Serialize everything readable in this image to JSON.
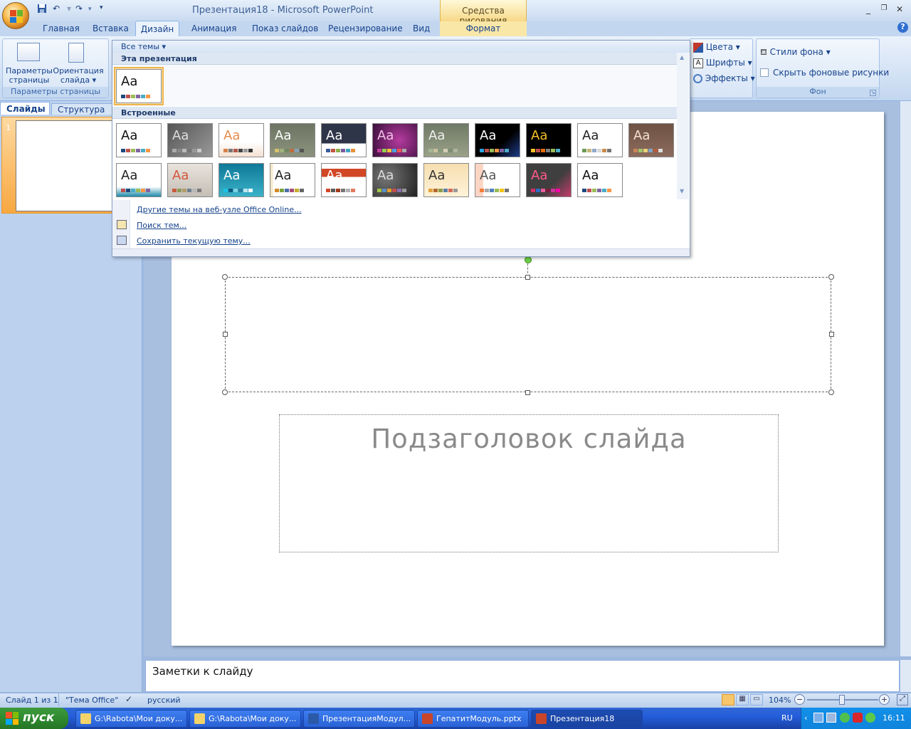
{
  "window": {
    "title": "Презентация18 - Microsoft PowerPoint",
    "contextual_tab_title": "Средства рисования"
  },
  "tabs": [
    "Главная",
    "Вставка",
    "Дизайн",
    "Анимация",
    "Показ слайдов",
    "Рецензирование",
    "Вид",
    "Формат"
  ],
  "active_tab": "Дизайн",
  "ribbon": {
    "page_setup": {
      "params_label_1": "Параметры",
      "params_label_2": "страницы",
      "orient_label_1": "Ориентация",
      "orient_label_2": "слайда",
      "group_label": "Параметры страницы"
    },
    "themes": {
      "colors": "Цвета",
      "fonts": "Шрифты",
      "effects": "Эффекты"
    },
    "background": {
      "styles": "Стили фона",
      "hide_graphics": "Скрыть фоновые рисунки",
      "group_label": "Фон"
    }
  },
  "gallery": {
    "header": "Все темы",
    "section_current": "Эта презентация",
    "section_builtin": "Встроенные",
    "theme_label": "Aa",
    "builtin_count": 21,
    "menu": {
      "more_online": "Другие темы на веб-узле Office Online...",
      "browse": "Поиск тем...",
      "save": "Сохранить текущую тему..."
    }
  },
  "left_pane": {
    "tab_slides": "Слайды",
    "tab_outline": "Структура",
    "slide_number": "1"
  },
  "slide": {
    "subtitle_placeholder": "Подзаголовок слайда"
  },
  "notes": {
    "placeholder": "Заметки к слайду"
  },
  "status": {
    "slide_info": "Слайд 1 из 1",
    "theme": "\"Тема Office\"",
    "language": "русский",
    "zoom": "104%"
  },
  "taskbar": {
    "start": "пуск",
    "buttons": [
      "G:\\Rabota\\Мои доку...",
      "G:\\Rabota\\Мои доку...",
      "ПрезентацияМодул...",
      "ГепатитМодуль.pptx",
      "Презентация18"
    ],
    "lang": "RU",
    "time": "16:11"
  }
}
